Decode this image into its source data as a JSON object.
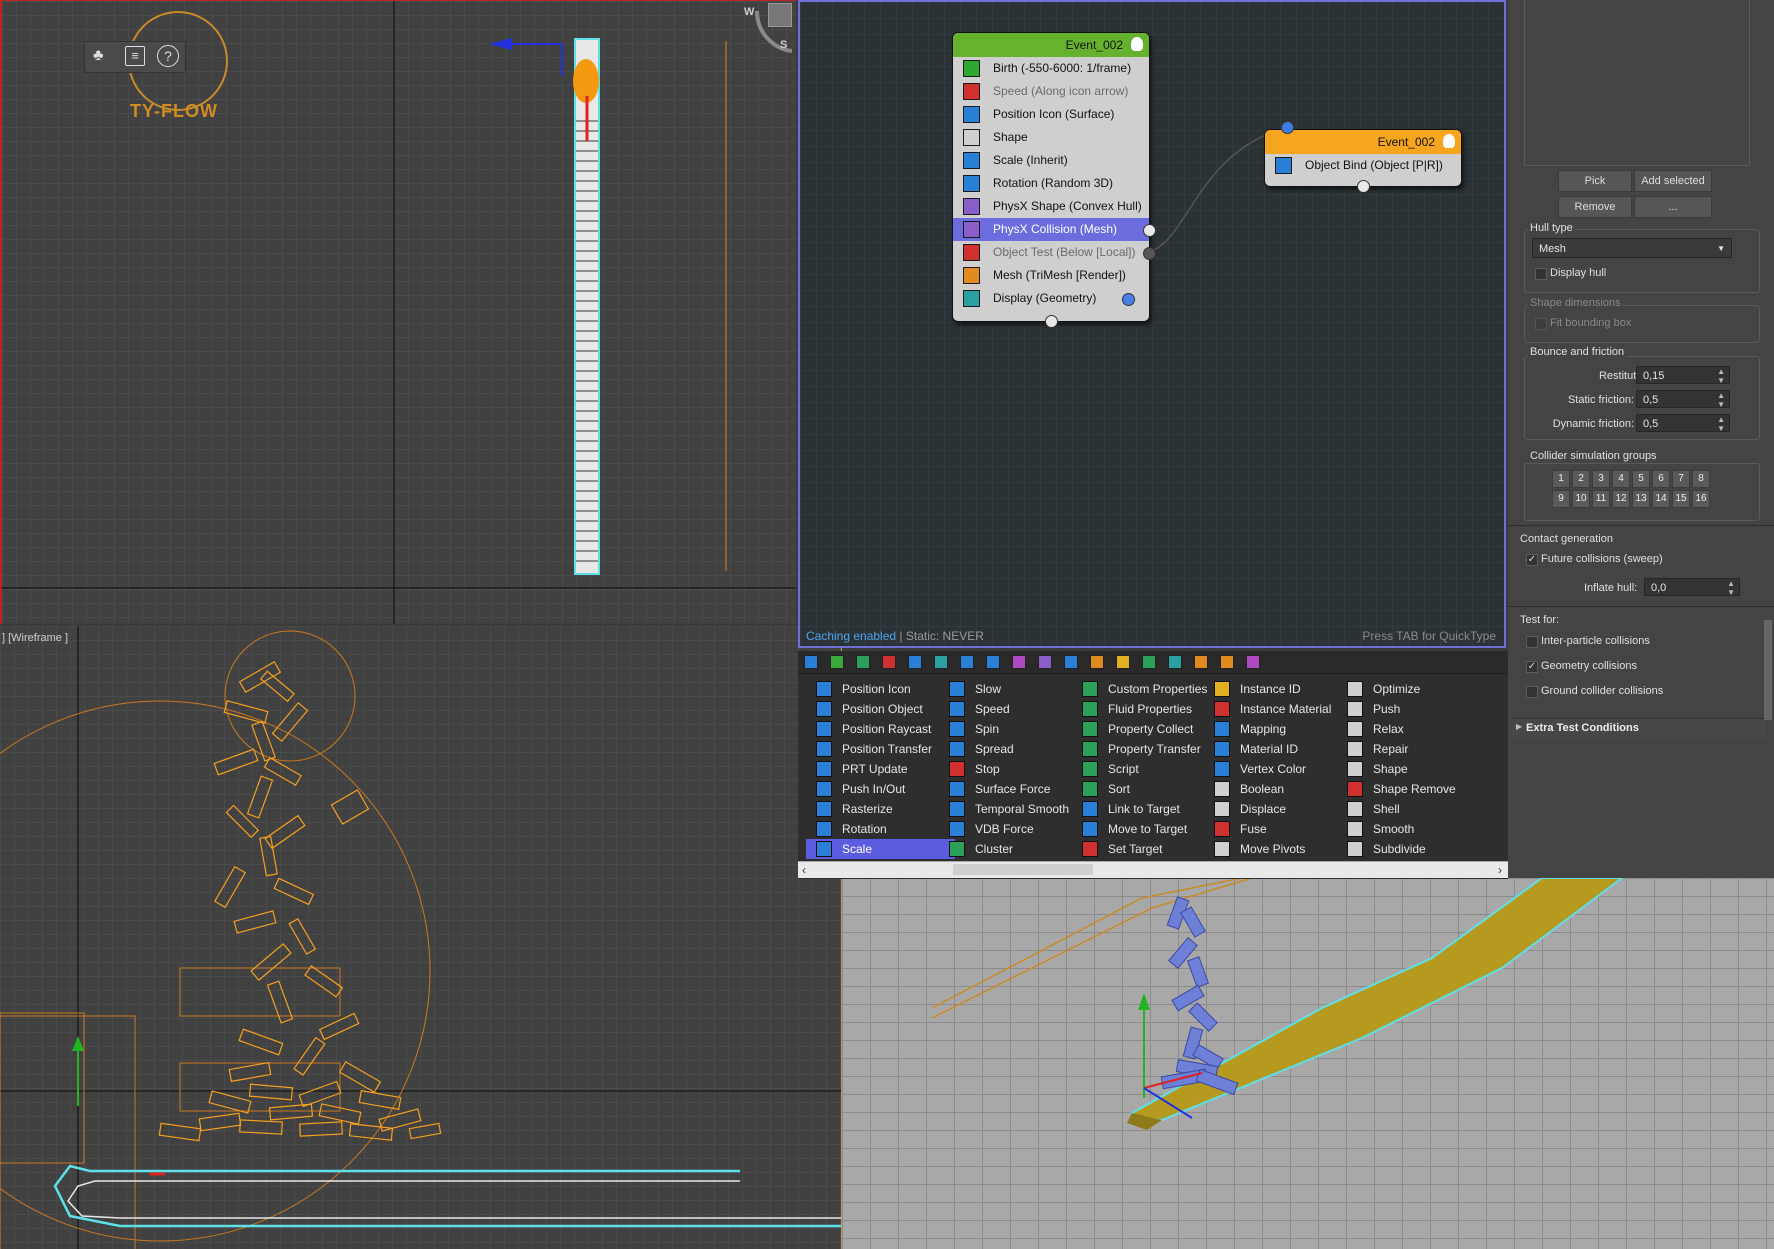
{
  "logo": {
    "text": "TY-FLOW"
  },
  "viewports": {
    "bottom_left_label": "] [Wireframe ]",
    "top_view_letters": {
      "w": "W",
      "s": "S"
    }
  },
  "flow": {
    "event_main": {
      "title": "Event_002",
      "operators": [
        {
          "label": "Birth (-550-6000: 1/frame)",
          "state": "normal",
          "icon_color": "#2fa82f"
        },
        {
          "label": "Speed (Along icon arrow)",
          "state": "disabled",
          "icon_color": "#d03030"
        },
        {
          "label": "Position Icon (Surface)",
          "state": "normal",
          "icon_color": "#2a7fd6"
        },
        {
          "label": "Shape",
          "state": "normal",
          "icon_color": "#cfcfcf"
        },
        {
          "label": "Scale (Inherit)",
          "state": "normal",
          "icon_color": "#2a7fd6"
        },
        {
          "label": "Rotation (Random 3D)",
          "state": "normal",
          "icon_color": "#2a7fd6"
        },
        {
          "label": "PhysX Shape (Convex Hull)",
          "state": "normal",
          "icon_color": "#8a5ec9"
        },
        {
          "label": "PhysX Collision (Mesh)",
          "state": "selected",
          "icon_color": "#8a5ec9"
        },
        {
          "label": "Object Test (Below [Local])",
          "state": "disabled",
          "icon_color": "#d03030"
        },
        {
          "label": "Mesh (TriMesh [Render])",
          "state": "normal",
          "icon_color": "#e08a20"
        },
        {
          "label": "Display (Geometry)",
          "state": "normal",
          "icon_color": "#2aa0a0"
        }
      ]
    },
    "event_bind": {
      "title": "Event_002",
      "operators": [
        {
          "label": "Object Bind (Object [P|R])",
          "state": "normal",
          "icon_color": "#2a7fd6"
        }
      ]
    },
    "status_left": "Caching enabled",
    "status_mid": " | Static: NEVER",
    "status_right": "Press TAB for QuickType"
  },
  "palette": {
    "columns": [
      [
        {
          "label": "Position Icon",
          "icon_color": "#2a7fd6"
        },
        {
          "label": "Position Object",
          "icon_color": "#2a7fd6"
        },
        {
          "label": "Position Raycast",
          "icon_color": "#2a7fd6"
        },
        {
          "label": "Position Transfer",
          "icon_color": "#2a7fd6"
        },
        {
          "label": "PRT Update",
          "icon_color": "#2a7fd6"
        },
        {
          "label": "Push In/Out",
          "icon_color": "#2a7fd6"
        },
        {
          "label": "Rasterize",
          "icon_color": "#2a7fd6"
        },
        {
          "label": "Rotation",
          "icon_color": "#2a7fd6"
        },
        {
          "label": "Scale",
          "icon_color": "#2a7fd6",
          "selected": true
        }
      ],
      [
        {
          "label": "Slow",
          "icon_color": "#2a7fd6"
        },
        {
          "label": "Speed",
          "icon_color": "#2a7fd6"
        },
        {
          "label": "Spin",
          "icon_color": "#2a7fd6"
        },
        {
          "label": "Spread",
          "icon_color": "#2a7fd6"
        },
        {
          "label": "Stop",
          "icon_color": "#d03030"
        },
        {
          "label": "Surface Force",
          "icon_color": "#2a7fd6"
        },
        {
          "label": "Temporal Smooth",
          "icon_color": "#2a7fd6"
        },
        {
          "label": "VDB Force",
          "icon_color": "#2a7fd6"
        },
        {
          "label": "Cluster",
          "icon_color": "#2aa05a"
        }
      ],
      [
        {
          "label": "Custom Properties",
          "icon_color": "#2aa05a"
        },
        {
          "label": "Fluid Properties",
          "icon_color": "#2aa05a"
        },
        {
          "label": "Property Collect",
          "icon_color": "#2aa05a"
        },
        {
          "label": "Property Transfer",
          "icon_color": "#2aa05a"
        },
        {
          "label": "Script",
          "icon_color": "#2aa05a"
        },
        {
          "label": "Sort",
          "icon_color": "#2aa05a"
        },
        {
          "label": "Link to Target",
          "icon_color": "#2a7fd6"
        },
        {
          "label": "Move to Target",
          "icon_color": "#2a7fd6"
        },
        {
          "label": "Set Target",
          "icon_color": "#d03030"
        }
      ],
      [
        {
          "label": "Instance ID",
          "icon_color": "#e0b020"
        },
        {
          "label": "Instance Material",
          "icon_color": "#d03030"
        },
        {
          "label": "Mapping",
          "icon_color": "#2a7fd6"
        },
        {
          "label": "Material ID",
          "icon_color": "#2a7fd6"
        },
        {
          "label": "Vertex Color",
          "icon_color": "#2a7fd6"
        },
        {
          "label": "Boolean",
          "icon_color": "#cfcfcf"
        },
        {
          "label": "Displace",
          "icon_color": "#cfcfcf"
        },
        {
          "label": "Fuse",
          "icon_color": "#d03030"
        },
        {
          "label": "Move Pivots",
          "icon_color": "#cfcfcf"
        }
      ],
      [
        {
          "label": "Optimize",
          "icon_color": "#cfcfcf"
        },
        {
          "label": "Push",
          "icon_color": "#cfcfcf"
        },
        {
          "label": "Relax",
          "icon_color": "#cfcfcf"
        },
        {
          "label": "Repair",
          "icon_color": "#cfcfcf"
        },
        {
          "label": "Shape",
          "icon_color": "#cfcfcf"
        },
        {
          "label": "Shape Remove",
          "icon_color": "#d03030"
        },
        {
          "label": "Shell",
          "icon_color": "#cfcfcf"
        },
        {
          "label": "Smooth",
          "icon_color": "#cfcfcf"
        },
        {
          "label": "Subdivide",
          "icon_color": "#cfcfcf"
        }
      ]
    ]
  },
  "panel": {
    "pick": "Pick",
    "add_selected": "Add selected",
    "remove": "Remove",
    "more": "...",
    "hull_type_label": "Hull type",
    "hull_type_value": "Mesh",
    "display_hull": "Display hull",
    "shape_dimensions_label": "Shape dimensions",
    "fit_bounding_box": "Fit bounding box",
    "bounce_label": "Bounce and friction",
    "restitution_label": "Restitution:",
    "restitution_value": "0,15",
    "static_friction_label": "Static friction:",
    "static_friction_value": "0,5",
    "dynamic_friction_label": "Dynamic friction:",
    "dynamic_friction_value": "0,5",
    "collider_groups_label": "Collider simulation groups",
    "groups": [
      "1",
      "2",
      "3",
      "4",
      "5",
      "6",
      "7",
      "8",
      "9",
      "10",
      "11",
      "12",
      "13",
      "14",
      "15",
      "16"
    ],
    "contact_label": "Contact generation",
    "future_collisions": "Future collisions (sweep)",
    "future_collisions_checked": true,
    "inflate_hull_label": "Inflate hull:",
    "inflate_hull_value": "0,0",
    "test_for_label": "Test for:",
    "inter_particle": "Inter-particle collisions",
    "geometry_collisions": "Geometry collisions",
    "geometry_checked": true,
    "ground_collider": "Ground collider collisions",
    "extra_test": "Extra Test Conditions"
  }
}
